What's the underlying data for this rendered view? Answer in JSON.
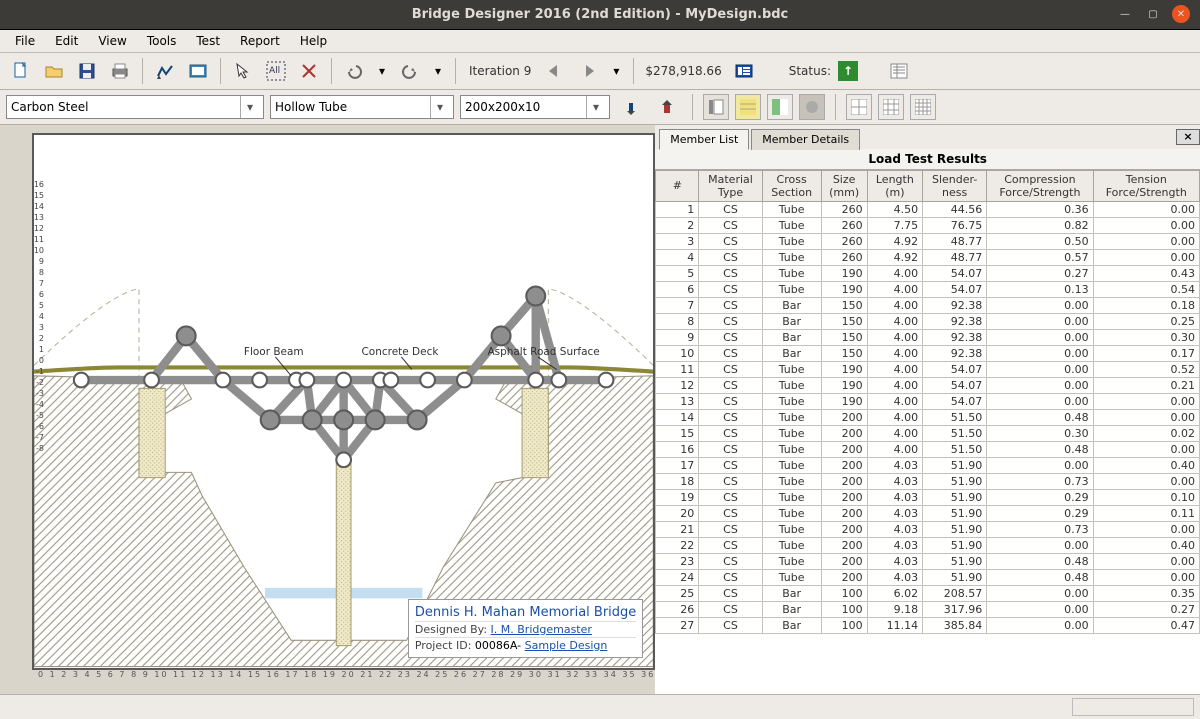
{
  "app": {
    "title": "Bridge Designer 2016 (2nd Edition) - MyDesign.bdc"
  },
  "menu": [
    "File",
    "Edit",
    "View",
    "Tools",
    "Test",
    "Report",
    "Help"
  ],
  "toolbar1": {
    "iteration_label": "Iteration 9",
    "cost": "$278,918.66",
    "status_label": "Status:"
  },
  "toolbar2": {
    "material": "Carbon Steel",
    "cross_section": "Hollow Tube",
    "size": "200x200x10"
  },
  "canvas": {
    "labels": {
      "floor_beam": "Floor Beam",
      "concrete_deck": "Concrete Deck",
      "asphalt": "Asphalt Road Surface"
    },
    "info": {
      "title": "Dennis H. Mahan Memorial Bridge",
      "designed_label": "Designed By:",
      "designed_by": "I. M. Bridgemaster",
      "project_label": "Project ID:",
      "project_id": "00086A-",
      "project_link": "Sample Design"
    },
    "v_ticks": [
      "16",
      "15",
      "14",
      "13",
      "12",
      "11",
      "10",
      "9",
      "8",
      "7",
      "6",
      "5",
      "4",
      "3",
      "2",
      "1",
      "0",
      "-1",
      "-2",
      "-3",
      "-4",
      "-5",
      "-6",
      "-7",
      "-8"
    ],
    "h_ticks": "0 1 2 3 4 5 6 7 8 9 10 11 12 13 14 15 16 17 18 19 20 21 22 23 24 25 26 27 28 29 30 31 32 33 34 35 36"
  },
  "right": {
    "tabs": {
      "list": "Member List",
      "details": "Member Details",
      "title": "Load Test Results"
    },
    "headers": [
      "#",
      "Material\nType",
      "Cross\nSection",
      "Size\n(mm)",
      "Length\n(m)",
      "Slender-\nness",
      "Compression\nForce/Strength",
      "Tension\nForce/Strength"
    ],
    "rows": [
      {
        "n": 1,
        "mat": "CS",
        "cs": "Tube",
        "size": 260,
        "len": "4.50",
        "slen": "44.56",
        "comp": "0.36",
        "ten": "0.00"
      },
      {
        "n": 2,
        "mat": "CS",
        "cs": "Tube",
        "size": 260,
        "len": "7.75",
        "slen": "76.75",
        "comp": "0.82",
        "ten": "0.00"
      },
      {
        "n": 3,
        "mat": "CS",
        "cs": "Tube",
        "size": 260,
        "len": "4.92",
        "slen": "48.77",
        "comp": "0.50",
        "ten": "0.00"
      },
      {
        "n": 4,
        "mat": "CS",
        "cs": "Tube",
        "size": 260,
        "len": "4.92",
        "slen": "48.77",
        "comp": "0.57",
        "ten": "0.00"
      },
      {
        "n": 5,
        "mat": "CS",
        "cs": "Tube",
        "size": 190,
        "len": "4.00",
        "slen": "54.07",
        "comp": "0.27",
        "ten": "0.43"
      },
      {
        "n": 6,
        "mat": "CS",
        "cs": "Tube",
        "size": 190,
        "len": "4.00",
        "slen": "54.07",
        "comp": "0.13",
        "ten": "0.54"
      },
      {
        "n": 7,
        "mat": "CS",
        "cs": "Bar",
        "size": 150,
        "len": "4.00",
        "slen": "92.38",
        "comp": "0.00",
        "ten": "0.18"
      },
      {
        "n": 8,
        "mat": "CS",
        "cs": "Bar",
        "size": 150,
        "len": "4.00",
        "slen": "92.38",
        "comp": "0.00",
        "ten": "0.25"
      },
      {
        "n": 9,
        "mat": "CS",
        "cs": "Bar",
        "size": 150,
        "len": "4.00",
        "slen": "92.38",
        "comp": "0.00",
        "ten": "0.30"
      },
      {
        "n": 10,
        "mat": "CS",
        "cs": "Bar",
        "size": 150,
        "len": "4.00",
        "slen": "92.38",
        "comp": "0.00",
        "ten": "0.17"
      },
      {
        "n": 11,
        "mat": "CS",
        "cs": "Tube",
        "size": 190,
        "len": "4.00",
        "slen": "54.07",
        "comp": "0.00",
        "ten": "0.52"
      },
      {
        "n": 12,
        "mat": "CS",
        "cs": "Tube",
        "size": 190,
        "len": "4.00",
        "slen": "54.07",
        "comp": "0.00",
        "ten": "0.21"
      },
      {
        "n": 13,
        "mat": "CS",
        "cs": "Tube",
        "size": 190,
        "len": "4.00",
        "slen": "54.07",
        "comp": "0.00",
        "ten": "0.00"
      },
      {
        "n": 14,
        "mat": "CS",
        "cs": "Tube",
        "size": 200,
        "len": "4.00",
        "slen": "51.50",
        "comp": "0.48",
        "ten": "0.00"
      },
      {
        "n": 15,
        "mat": "CS",
        "cs": "Tube",
        "size": 200,
        "len": "4.00",
        "slen": "51.50",
        "comp": "0.30",
        "ten": "0.02"
      },
      {
        "n": 16,
        "mat": "CS",
        "cs": "Tube",
        "size": 200,
        "len": "4.00",
        "slen": "51.50",
        "comp": "0.48",
        "ten": "0.00"
      },
      {
        "n": 17,
        "mat": "CS",
        "cs": "Tube",
        "size": 200,
        "len": "4.03",
        "slen": "51.90",
        "comp": "0.00",
        "ten": "0.40"
      },
      {
        "n": 18,
        "mat": "CS",
        "cs": "Tube",
        "size": 200,
        "len": "4.03",
        "slen": "51.90",
        "comp": "0.73",
        "ten": "0.00"
      },
      {
        "n": 19,
        "mat": "CS",
        "cs": "Tube",
        "size": 200,
        "len": "4.03",
        "slen": "51.90",
        "comp": "0.29",
        "ten": "0.10"
      },
      {
        "n": 20,
        "mat": "CS",
        "cs": "Tube",
        "size": 200,
        "len": "4.03",
        "slen": "51.90",
        "comp": "0.29",
        "ten": "0.11"
      },
      {
        "n": 21,
        "mat": "CS",
        "cs": "Tube",
        "size": 200,
        "len": "4.03",
        "slen": "51.90",
        "comp": "0.73",
        "ten": "0.00"
      },
      {
        "n": 22,
        "mat": "CS",
        "cs": "Tube",
        "size": 200,
        "len": "4.03",
        "slen": "51.90",
        "comp": "0.00",
        "ten": "0.40"
      },
      {
        "n": 23,
        "mat": "CS",
        "cs": "Tube",
        "size": 200,
        "len": "4.03",
        "slen": "51.90",
        "comp": "0.48",
        "ten": "0.00"
      },
      {
        "n": 24,
        "mat": "CS",
        "cs": "Tube",
        "size": 200,
        "len": "4.03",
        "slen": "51.90",
        "comp": "0.48",
        "ten": "0.00"
      },
      {
        "n": 25,
        "mat": "CS",
        "cs": "Bar",
        "size": 100,
        "len": "6.02",
        "slen": "208.57",
        "comp": "0.00",
        "ten": "0.35"
      },
      {
        "n": 26,
        "mat": "CS",
        "cs": "Bar",
        "size": 100,
        "len": "9.18",
        "slen": "317.96",
        "comp": "0.00",
        "ten": "0.27"
      },
      {
        "n": 27,
        "mat": "CS",
        "cs": "Bar",
        "size": 100,
        "len": "11.14",
        "slen": "385.84",
        "comp": "0.00",
        "ten": "0.47"
      }
    ]
  }
}
